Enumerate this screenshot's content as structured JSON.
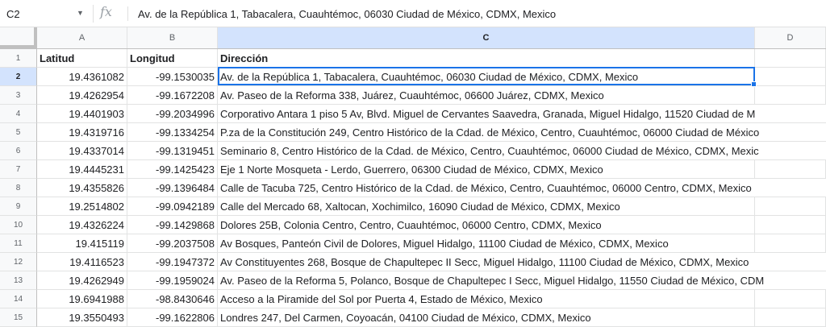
{
  "name_box": "C2",
  "formula_value": "Av. de la República 1, Tabacalera, Cuauhtémoc, 06030 Ciudad de México, CDMX, Mexico",
  "columns": [
    "A",
    "B",
    "C",
    "D"
  ],
  "row_numbers": [
    "1",
    "2",
    "3",
    "4",
    "5",
    "6",
    "7",
    "8",
    "9",
    "10",
    "11",
    "12",
    "13",
    "14",
    "15"
  ],
  "headers": {
    "a": "Latitud",
    "b": "Longitud",
    "c": "Dirección"
  },
  "rows": [
    {
      "a": "19.4361082",
      "b": "-99.1530035",
      "c": "Av. de la República 1, Tabacalera, Cuauhtémoc, 06030 Ciudad de México, CDMX, Mexico"
    },
    {
      "a": "19.4262954",
      "b": "-99.1672208",
      "c": "Av. Paseo de la Reforma 338, Juárez, Cuauhtémoc, 06600 Juárez, CDMX, Mexico"
    },
    {
      "a": "19.4401903",
      "b": "-99.2034996",
      "c": "Corporativo Antara 1 piso 5 Av, Blvd. Miguel de Cervantes Saavedra, Granada, Miguel Hidalgo, 11520 Ciudad de M"
    },
    {
      "a": "19.4319716",
      "b": "-99.1334254",
      "c": "P.za de la Constitución 249, Centro Histórico de la Cdad. de México, Centro, Cuauhtémoc, 06000 Ciudad de México"
    },
    {
      "a": "19.4337014",
      "b": "-99.1319451",
      "c": "Seminario 8, Centro Histórico de la Cdad. de México, Centro, Cuauhtémoc, 06000 Ciudad de México, CDMX, Mexic"
    },
    {
      "a": "19.4445231",
      "b": "-99.1425423",
      "c": "Eje 1 Norte Mosqueta - Lerdo, Guerrero, 06300 Ciudad de México, CDMX, Mexico"
    },
    {
      "a": "19.4355826",
      "b": "-99.1396484",
      "c": "Calle de Tacuba 725, Centro Histórico de la Cdad. de México, Centro, Cuauhtémoc, 06000 Centro, CDMX, Mexico"
    },
    {
      "a": "19.2514802",
      "b": "-99.0942189",
      "c": "Calle del Mercado 68, Xaltocan, Xochimilco, 16090 Ciudad de México, CDMX, Mexico"
    },
    {
      "a": "19.4326224",
      "b": "-99.1429868",
      "c": "Dolores 25B, Colonia Centro, Centro, Cuauhtémoc, 06000 Centro, CDMX, Mexico"
    },
    {
      "a": "19.415119",
      "b": "-99.2037508",
      "c": "Av Bosques, Panteón Civil de Dolores, Miguel Hidalgo, 11100 Ciudad de México, CDMX, Mexico"
    },
    {
      "a": "19.4116523",
      "b": "-99.1947372",
      "c": "Av Constituyentes 268, Bosque de Chapultepec II Secc, Miguel Hidalgo, 11100 Ciudad de México, CDMX, Mexico"
    },
    {
      "a": "19.4262949",
      "b": "-99.1959024",
      "c": "Av. Paseo de la Reforma 5, Polanco, Bosque de Chapultepec I Secc, Miguel Hidalgo, 11550 Ciudad de México, CDM"
    },
    {
      "a": "19.6941988",
      "b": "-98.8430646",
      "c": "Acceso a la Piramide del Sol por Puerta 4, Estado de México, Mexico"
    },
    {
      "a": "19.3550493",
      "b": "-99.1622806",
      "c": "Londres 247, Del Carmen, Coyoacán, 04100 Ciudad de México, CDMX, Mexico"
    }
  ]
}
